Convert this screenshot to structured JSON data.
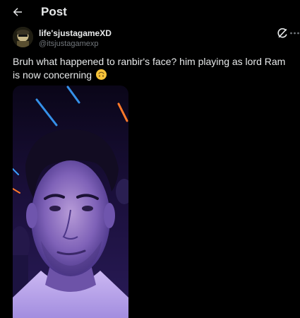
{
  "header": {
    "title": "Post",
    "back_icon": "arrow-left-icon"
  },
  "post": {
    "author": {
      "display_name": "life'sjustagameXD",
      "handle": "@itsjustagamexp",
      "avatar_icon": "avatar-image"
    },
    "text": "Bruh what happened to ranbir's face? him playing as lord Ram is now concerning",
    "emoji": "upside-down-face-emoji",
    "actions": {
      "grok_icon": "grok-icon",
      "more_icon": "more-horizontal-icon"
    },
    "media": {
      "type": "photo"
    }
  },
  "colors": {
    "background": "#000000",
    "text_primary": "#e7e9ea",
    "text_secondary": "#71767b",
    "media_tint": "#6a4fe0"
  }
}
